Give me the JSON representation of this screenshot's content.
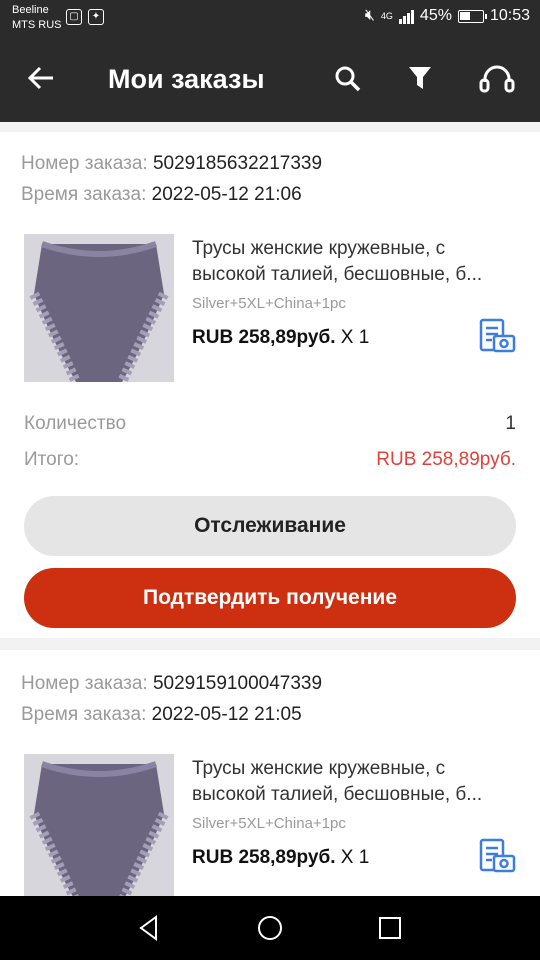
{
  "status_bar": {
    "carrier_1": "Beeline",
    "carrier_2": "MTS RUS",
    "network": "4G",
    "battery": "45%",
    "time": "10:53"
  },
  "header": {
    "title": "Мои заказы",
    "icons": [
      "back-arrow-icon",
      "search-icon",
      "filter-icon",
      "support-headset-icon"
    ]
  },
  "orders": [
    {
      "number_label": "Номер заказа:",
      "number": "5029185632217339",
      "time_label": "Время заказа:",
      "time": "2022-05-12 21:06",
      "product_name": "Трусы женские кружевные, с высокой талией, бесшовные, б...",
      "sku": "Silver+5XL+China+1pc",
      "price": "RUB 258,89руб.",
      "multiplier": "X 1",
      "quantity_label": "Количество",
      "quantity": "1",
      "total_label": "Итого:",
      "total": "RUB 258,89руб.",
      "track_button": "Отслеживание",
      "confirm_button": "Подтвердить получение"
    },
    {
      "number_label": "Номер заказа:",
      "number": "5029159100047339",
      "time_label": "Время заказа:",
      "time": "2022-05-12 21:05",
      "product_name": "Трусы женские кружевные, с высокой талией, бесшовные, б...",
      "sku": "Silver+5XL+China+1pc",
      "price": "RUB 258,89руб.",
      "multiplier": "X 1"
    }
  ],
  "colors": {
    "app_bar": "#2b2b2b",
    "accent_red": "#cc3010",
    "price_red": "#e0413a",
    "icon_blue": "#3b7de0"
  }
}
